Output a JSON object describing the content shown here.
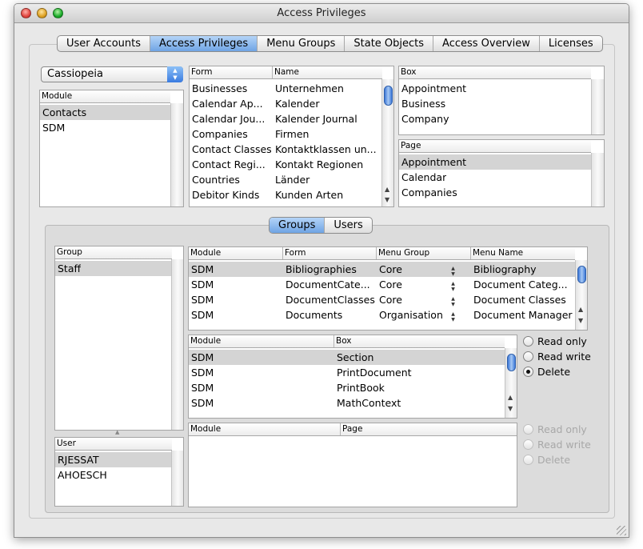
{
  "window": {
    "title": "Access Privileges"
  },
  "tabs": [
    "User Accounts",
    "Access Privileges",
    "Menu Groups",
    "State Objects",
    "Access Overview",
    "Licenses"
  ],
  "selected_tab": "Access Privileges",
  "colors": {
    "tab_selected": "#6fa4e4",
    "row_selected": "#d4d4d4",
    "scroll_thumb": "#3c78d8",
    "close": "#e0443e",
    "minimize": "#dea123",
    "zoom": "#1aab29"
  },
  "popup": {
    "value": "Cassiopeia"
  },
  "module_list": {
    "header": "Module",
    "items": [
      "Contacts",
      "SDM"
    ]
  },
  "form_table": {
    "headers": [
      "Form",
      "Name"
    ],
    "rows": [
      [
        "Businesses",
        "Unternehmen"
      ],
      [
        "Calendar Ap...",
        "Kalender"
      ],
      [
        "Calendar Jou...",
        "Kalender Journal"
      ],
      [
        "Companies",
        "Firmen"
      ],
      [
        "Contact Classes",
        "Kontaktklassen un..."
      ],
      [
        "Contact Regi...",
        "Kontakt Regionen"
      ],
      [
        "Countries",
        "Länder"
      ],
      [
        "Debitor Kinds",
        "Kunden Arten"
      ]
    ]
  },
  "box_list": {
    "header": "Box",
    "items": [
      "Appointment",
      "Business",
      "Company"
    ]
  },
  "page_list": {
    "header": "Page",
    "items": [
      "Appointment",
      "Calendar",
      "Companies"
    ]
  },
  "sub_tabs": [
    "Groups",
    "Users"
  ],
  "selected_sub_tab": "Groups",
  "group_list": {
    "header": "Group",
    "items": [
      "Staff"
    ]
  },
  "user_list": {
    "header": "User",
    "items": [
      "RJESSAT",
      "AHOESCH"
    ]
  },
  "menu_table": {
    "headers": [
      "Module",
      "Form",
      "Menu Group",
      "Menu Name"
    ],
    "rows": [
      [
        "SDM",
        "Bibliographies",
        "Core",
        "Bibliography"
      ],
      [
        "SDM",
        "DocumentCate...",
        "Core",
        "Document Categ..."
      ],
      [
        "SDM",
        "DocumentClasses",
        "Core",
        "Document Classes"
      ],
      [
        "SDM",
        "Documents",
        "Organisation",
        "Document Manager"
      ]
    ]
  },
  "box_table": {
    "headers": [
      "Module",
      "Box"
    ],
    "rows": [
      [
        "SDM",
        "Section"
      ],
      [
        "SDM",
        "PrintDocument"
      ],
      [
        "SDM",
        "PrintBook"
      ],
      [
        "SDM",
        "MathContext"
      ]
    ]
  },
  "page_table": {
    "headers": [
      "Module",
      "Page"
    ],
    "rows": []
  },
  "box_access": {
    "options": [
      "Read only",
      "Read write",
      "Delete"
    ],
    "selected": "Delete",
    "enabled": true
  },
  "page_access": {
    "options": [
      "Read only",
      "Read write",
      "Delete"
    ],
    "selected": "",
    "enabled": false
  },
  "icons": {
    "popup": "up-down-arrows-icon",
    "stepper": "stepper-arrows-icon",
    "resize": "resize-grip-icon",
    "splitter": "splitter-dot-icon"
  }
}
